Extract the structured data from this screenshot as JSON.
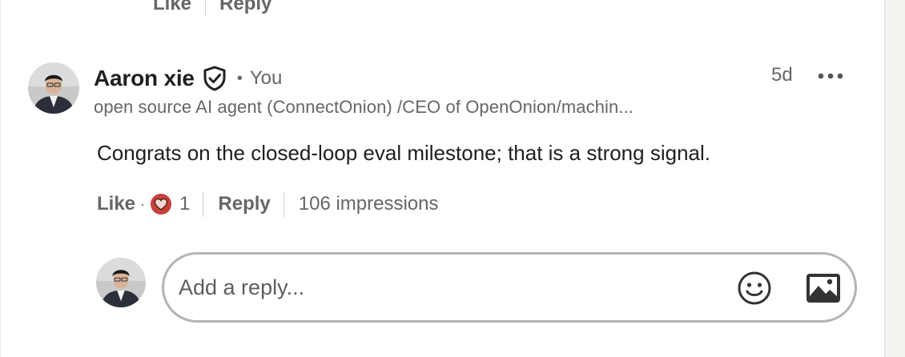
{
  "previous_comment": {
    "like_label": "Like",
    "reply_label": "Reply"
  },
  "comment": {
    "author_name": "Aaron xie",
    "verified_icon": "verified-shield-icon",
    "separator": "•",
    "relation": "You",
    "timestamp": "5d",
    "headline": "open source AI agent (ConnectOnion) /CEO of OpenOnion/machin...",
    "text": "Congrats on the closed-loop eval milestone; that is a strong signal.",
    "more_icon": "more-horizontal-icon",
    "actions": {
      "like_label": "Like",
      "dot": "·",
      "reaction_icon": "love-reaction-icon",
      "reaction_count": "1",
      "reply_label": "Reply",
      "impressions": "106 impressions"
    }
  },
  "reply_composer": {
    "placeholder": "Add a reply...",
    "emoji_icon": "emoji-icon",
    "image_icon": "image-icon"
  },
  "colors": {
    "text_primary": "#1f1f1f",
    "text_secondary": "#666666",
    "reaction_love": "#c6403a",
    "border": "#b4b4b4"
  }
}
